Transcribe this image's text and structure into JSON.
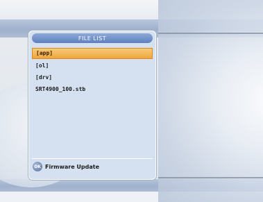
{
  "panel": {
    "title": "FILE LIST",
    "items": [
      {
        "label": "[app]"
      },
      {
        "label": "[ol]"
      },
      {
        "label": "[drv]"
      },
      {
        "label": "SRT4900_100.stb"
      }
    ],
    "selected_index": 0
  },
  "footer": {
    "ok_icon_label": "OK",
    "action_label": "Firmware Update"
  },
  "colors": {
    "selection": "#f0a63d",
    "panel_bg": "#d5e1f0",
    "title_bar": "#5e7fc0"
  }
}
